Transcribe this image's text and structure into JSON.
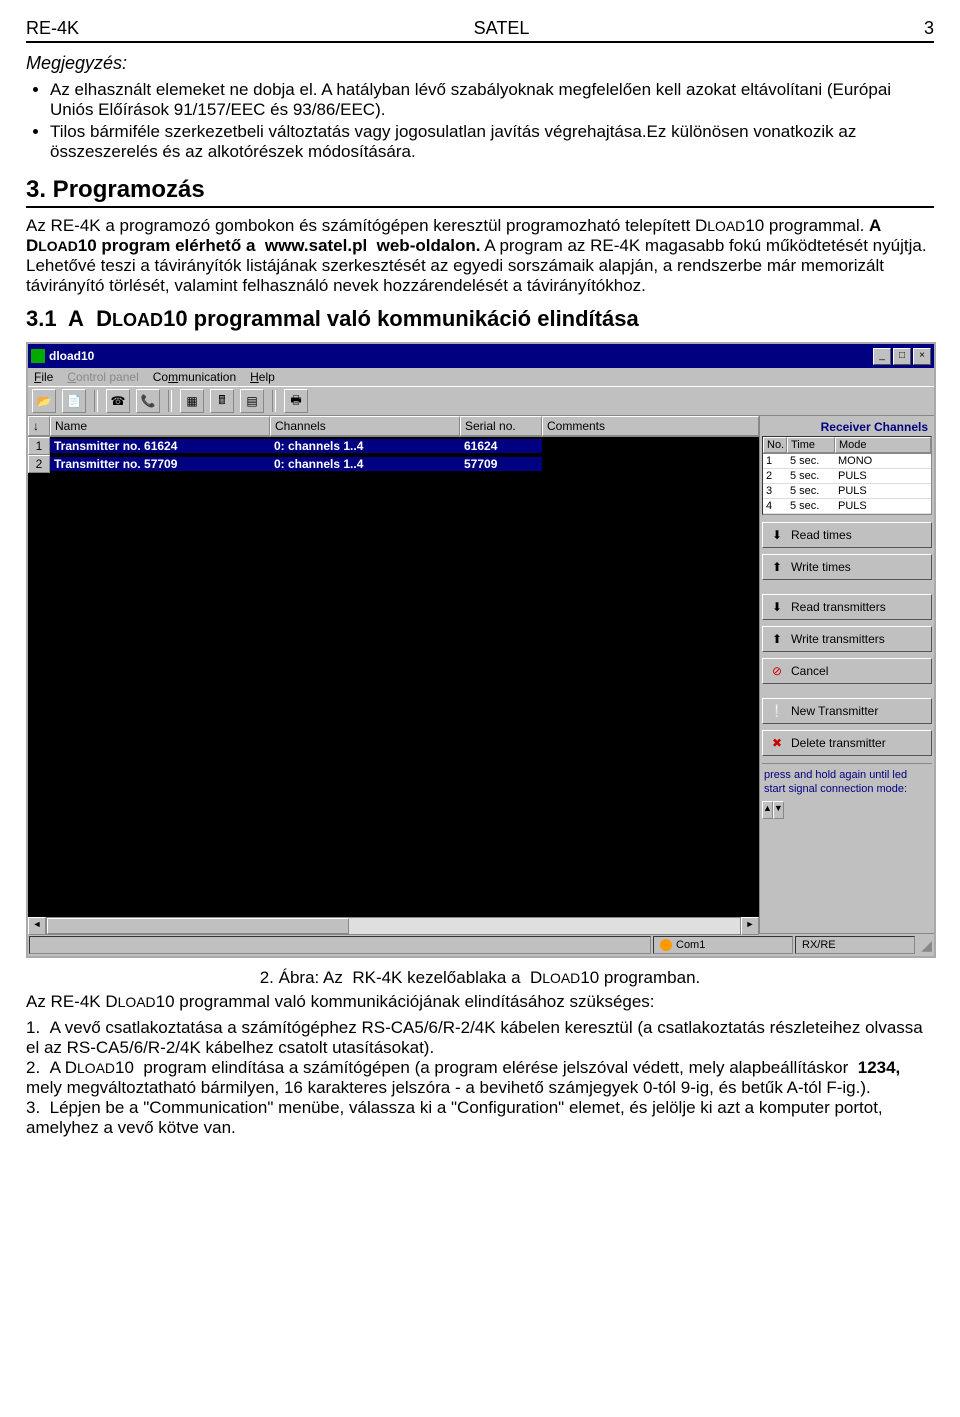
{
  "header": {
    "left": "RE-4K",
    "center": "SATEL",
    "right": "3"
  },
  "note": {
    "title": "Megjegyzés:",
    "bullets": [
      "Az elhasznált elemeket ne dobja el. A hatályban lévő szabályoknak megfelelően kell azokat eltávolítani (Európai Uniós Előírások 91/157/EEC és 93/86/EEC).",
      "Tilos bármiféle szerkezetbeli változtatás vagy jogosulatlan javítás végrehajtása.Ez különösen vonatkozik az összeszerelés és az alkotórészek módosítására."
    ]
  },
  "section3": {
    "title": "3. Programozás",
    "para": "Az RE-4K a programozó gombokon és számítógépen keresztül programozható telepített DLOAD10 programmal. A DLOAD10 program elérhető a  www.satel.pl  web-oldalon. A program az RE-4K magasabb fokú működtetését nyújtja. Lehetővé teszi a távirányítók listájának szerkesztését az egyedi sorszámaik alapján, a rendszerbe már memorizált távirányító törlését, valamint felhasználó nevek hozzárendelését a távirányítókhoz.",
    "sub": "3.1  A  DLOAD10 programmal való kommunikáció elindítása"
  },
  "app": {
    "title": "dload10",
    "menu": {
      "file": "File",
      "control": "Control panel",
      "comm": "Communication",
      "help": "Help"
    },
    "cols": {
      "num": "↓",
      "name": "Name",
      "ch": "Channels",
      "ser": "Serial no.",
      "comm": "Comments"
    },
    "rows": [
      {
        "n": "1",
        "name": "Transmitter no. 61624",
        "ch": "0: channels 1..4",
        "ser": "61624",
        "comm": ""
      },
      {
        "n": "2",
        "name": "Transmitter no. 57709",
        "ch": "0: channels 1..4",
        "ser": "57709",
        "comm": ""
      }
    ],
    "right": {
      "title": "Receiver Channels",
      "head": {
        "no": "No.",
        "time": "Time",
        "mode": "Mode"
      },
      "rows": [
        {
          "no": "1",
          "time": "5 sec.",
          "mode": "MONO"
        },
        {
          "no": "2",
          "time": "5 sec.",
          "mode": "PULS"
        },
        {
          "no": "3",
          "time": "5 sec.",
          "mode": "PULS"
        },
        {
          "no": "4",
          "time": "5 sec.",
          "mode": "PULS"
        }
      ],
      "buttons": {
        "read_times": "Read times",
        "write_times": "Write times",
        "read_trans": "Read transmitters",
        "write_trans": "Write transmitters",
        "cancel": "Cancel",
        "new_trans": "New Transmitter",
        "del_trans": "Delete transmitter"
      },
      "hint": "press and hold again until led start signal connection mode:"
    },
    "status": {
      "com": "Com1",
      "rx": "RX/RE"
    }
  },
  "caption": "2. Ábra: Az  RK-4K kezelőablaka a  DLOAD10 programban.",
  "after": {
    "line": "Az RE-4K DLOAD10 programmal való kommunikációjának elindításához szükséges:",
    "items": [
      "A vevő csatlakoztatása a számítógéphez RS-CA5/6/R-2/4K kábelen keresztül (a csatlakoztatás részleteihez olvassa el az RS-CA5/6/R-2/4K kábelhez csatolt utasításokat).",
      "A DLOAD10  program elindítása a számítógépen (a program elérése jelszóval védett, mely alapbeállításkor  1234, mely megváltoztatható bármilyen, 16 karakteres jelszóra - a bevihető számjegyek 0-tól 9-ig, és betűk A-tól F-ig.).",
      "Lépjen be a \"Communication\" menübe, válassza ki a  \"Configuration\" elemet, és jelölje ki azt a komputer portot, amelyhez a vevő kötve van."
    ]
  }
}
